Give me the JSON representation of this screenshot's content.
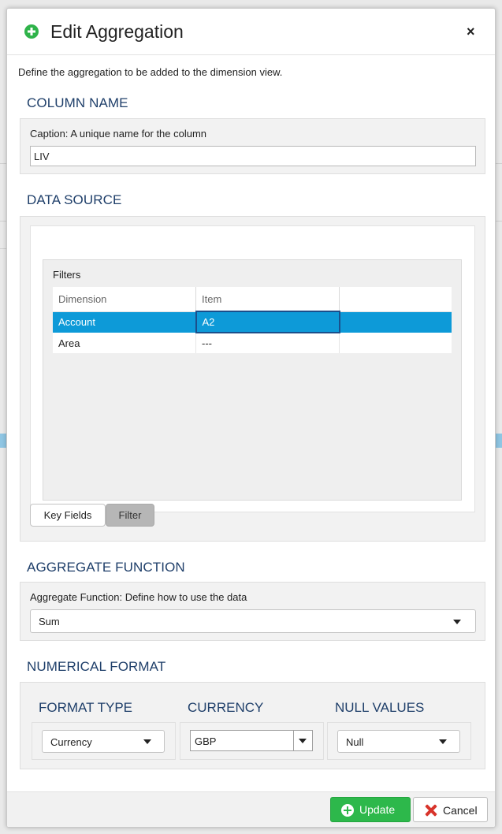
{
  "dialog": {
    "title": "Edit Aggregation",
    "close_glyph": "×",
    "intro": "Define the aggregation to be added to the dimension view."
  },
  "column_name": {
    "heading": "COLUMN NAME",
    "caption_label": "Caption: A unique name for the column",
    "caption_value": "LIV"
  },
  "data_source": {
    "heading": "DATA SOURCE",
    "filters_label": "Filters",
    "columns": [
      "Dimension",
      "Item",
      ""
    ],
    "rows": [
      {
        "dimension": "Account",
        "item": "A2",
        "selected": true
      },
      {
        "dimension": "Area",
        "item": "---",
        "selected": false
      }
    ],
    "tabs": [
      {
        "label": "Key Fields",
        "active": false
      },
      {
        "label": "Filter",
        "active": true
      }
    ]
  },
  "aggregate_function": {
    "heading": "AGGREGATE FUNCTION",
    "label": "Aggregate Function: Define how to use the data",
    "selected": "Sum"
  },
  "numerical_format": {
    "heading": "NUMERICAL FORMAT",
    "format_type": {
      "heading": "FORMAT TYPE",
      "selected": "Currency"
    },
    "currency": {
      "heading": "CURRENCY",
      "selected": "GBP"
    },
    "null_values": {
      "heading": "NULL VALUES",
      "selected": "Null"
    }
  },
  "footer": {
    "update_label": "Update",
    "cancel_label": "Cancel"
  },
  "colors": {
    "accent_green": "#2db84b",
    "selection_blue": "#0d9ad8",
    "heading_navy": "#1f3f6a",
    "cancel_red": "#d8342b"
  }
}
